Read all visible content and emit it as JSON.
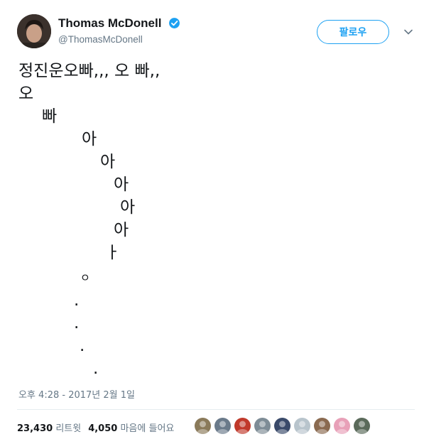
{
  "user": {
    "display_name": "Thomas McDonell",
    "handle": "@ThomasMcDonell",
    "verified": true
  },
  "follow_label": "팔로우",
  "tweet_lines": [
    "정진운오빠,,, 오 빠,,",
    "오",
    "빠",
    "아",
    "아",
    "아",
    "아",
    "아",
    "ㅏ",
    "ㅇ",
    ".",
    ".",
    ".",
    "."
  ],
  "timestamp": "오후 4:28 - 2017년 2월 1일",
  "stats": {
    "retweets": "23,430",
    "retweets_label": "리트윗",
    "likes": "4,050",
    "likes_label": "마음에 들어요"
  },
  "colors": {
    "accent": "#1da1f2",
    "secondary_text": "#657786",
    "divider": "#e6ecf0"
  },
  "liker_colors": [
    "#8a7a5a",
    "#6a7a8a",
    "#c0392b",
    "#7e8c96",
    "#3a4a6a",
    "#b8c4cc",
    "#8a6a50",
    "#e8a0b8",
    "#5a6a5a"
  ]
}
